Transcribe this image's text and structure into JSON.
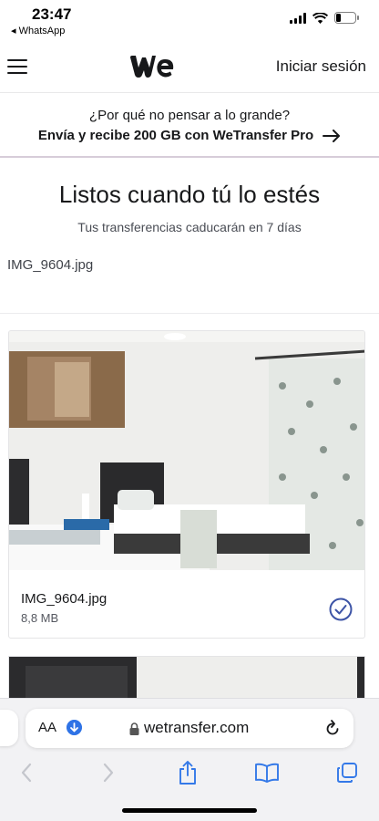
{
  "status_bar": {
    "time": "23:47",
    "back_app": "◂ WhatsApp"
  },
  "header": {
    "logo": "we",
    "login_label": "Iniciar sesión"
  },
  "promo": {
    "question": "¿Por qué no pensar a lo grande?",
    "cta": "Envía y recibe 200 GB con WeTransfer Pro",
    "cta_arrow": "→"
  },
  "main": {
    "headline": "Listos cuando tú lo estés",
    "subheadline": "Tus transferencias caducarán en 7 días",
    "file_name": "IMG_9604.jpg"
  },
  "files": [
    {
      "name": "IMG_9604.jpg",
      "size": "8,8 MB",
      "status": "check-circle-icon"
    }
  ],
  "browser": {
    "text_size": "AA",
    "url": "wetransfer.com",
    "accent_color": "#2f73e6"
  },
  "colors": {
    "check_blue": "#3d54a6",
    "promo_border": "#d7ccd9"
  }
}
